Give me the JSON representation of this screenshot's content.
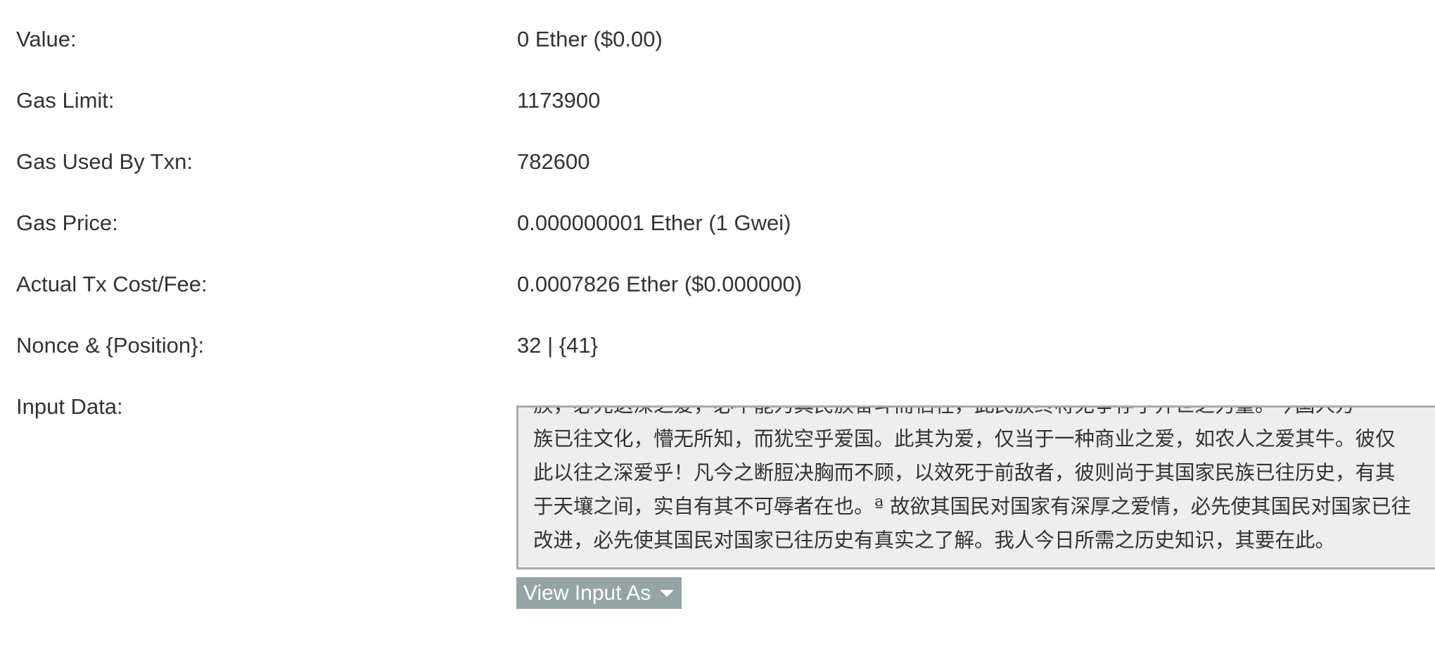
{
  "details": [
    {
      "key": "value",
      "label": "Value:",
      "value": "0 Ether ($0.00)"
    },
    {
      "key": "gas_limit",
      "label": "Gas Limit:",
      "value": "1173900"
    },
    {
      "key": "gas_used",
      "label": "Gas Used By Txn:",
      "value": "782600"
    },
    {
      "key": "gas_price",
      "label": "Gas Price:",
      "value": "0.000000001 Ether (1 Gwei)"
    },
    {
      "key": "tx_fee",
      "label": "Actual Tx Cost/Fee:",
      "value": "0.0007826 Ether ($0.000000)"
    },
    {
      "key": "nonce",
      "label": "Nonce & {Position}:",
      "value": "32 | {41}"
    }
  ],
  "input_data": {
    "label": "Input Data:",
    "lines": [
      "族，必先这深之爱，必不能为其民族奋斗而牺牲，此民族终将无争存于并世之力量。今国人方",
      "族已往文化，懵无所知，而犹空乎爱国。此其为爱，仅当于一种商业之爱，如农人之爱其牛。彼仅",
      "此以往之深爱乎！凡今之断脰决胸而不顾，以效死于前敌者，彼则尚于其国家民族已往历史，有其",
      "于天壤之间，实自有其不可辱者在也。ª 故欲其国民对国家有深厚之爱情，必先使其国民对国家已往",
      "改进，必先使其国民对国家已往历史有真实之了解。我人今日所需之历史知识，其要在此。"
    ],
    "view_button_label": "View Input As"
  }
}
